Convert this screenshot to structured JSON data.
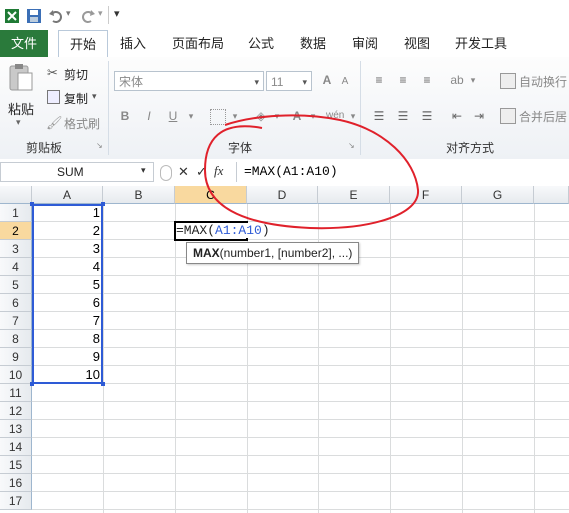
{
  "quick_access": {
    "icons": [
      "excel-logo-icon",
      "save-icon",
      "undo-icon",
      "redo-icon",
      "customize-icon"
    ]
  },
  "tabs": [
    {
      "label": "文件",
      "name": "tab-file"
    },
    {
      "label": "开始",
      "name": "tab-home"
    },
    {
      "label": "插入",
      "name": "tab-insert"
    },
    {
      "label": "页面布局",
      "name": "tab-page-layout"
    },
    {
      "label": "公式",
      "name": "tab-formulas"
    },
    {
      "label": "数据",
      "name": "tab-data"
    },
    {
      "label": "审阅",
      "name": "tab-review"
    },
    {
      "label": "视图",
      "name": "tab-view"
    },
    {
      "label": "开发工具",
      "name": "tab-developer"
    }
  ],
  "ribbon": {
    "clipboard": {
      "paste": "粘贴",
      "cut": "剪切",
      "copy": "复制",
      "format_painter": "格式刷",
      "group": "剪贴板"
    },
    "font": {
      "font_name": "宋体",
      "font_size": "11",
      "bold": "B",
      "italic": "I",
      "underline": "U",
      "group": "字体",
      "grow": "A",
      "shrink": "A"
    },
    "alignment": {
      "wrap_text": "自动换行",
      "merge_center": "合并后居",
      "group": "对齐方式"
    }
  },
  "formula_bar": {
    "name_box": "SUM",
    "fx": "fx",
    "formula": "=MAX(A1:A10)",
    "cancel": "✕",
    "enter": "✓"
  },
  "sheet": {
    "columns": [
      "A",
      "B",
      "C",
      "D",
      "E",
      "F",
      "G"
    ],
    "rows": [
      "1",
      "2",
      "3",
      "4",
      "5",
      "6",
      "7",
      "8",
      "9",
      "10",
      "11",
      "12",
      "13",
      "14",
      "15",
      "16",
      "17"
    ],
    "column_a_values": [
      "1",
      "2",
      "3",
      "4",
      "5",
      "6",
      "7",
      "8",
      "9",
      "10"
    ],
    "active_cell": "C2",
    "edit_text": {
      "prefix": "=MAX(",
      "ref": "A1:A10",
      "suffix": ")"
    },
    "tooltip": {
      "func": "MAX",
      "args": "(number1, [number2], ...)"
    }
  },
  "colors": {
    "accent": "#2a7a3b",
    "selection": "#2e5bd6",
    "annotation": "#e0212b",
    "header_highlight": "#f9d99f"
  }
}
